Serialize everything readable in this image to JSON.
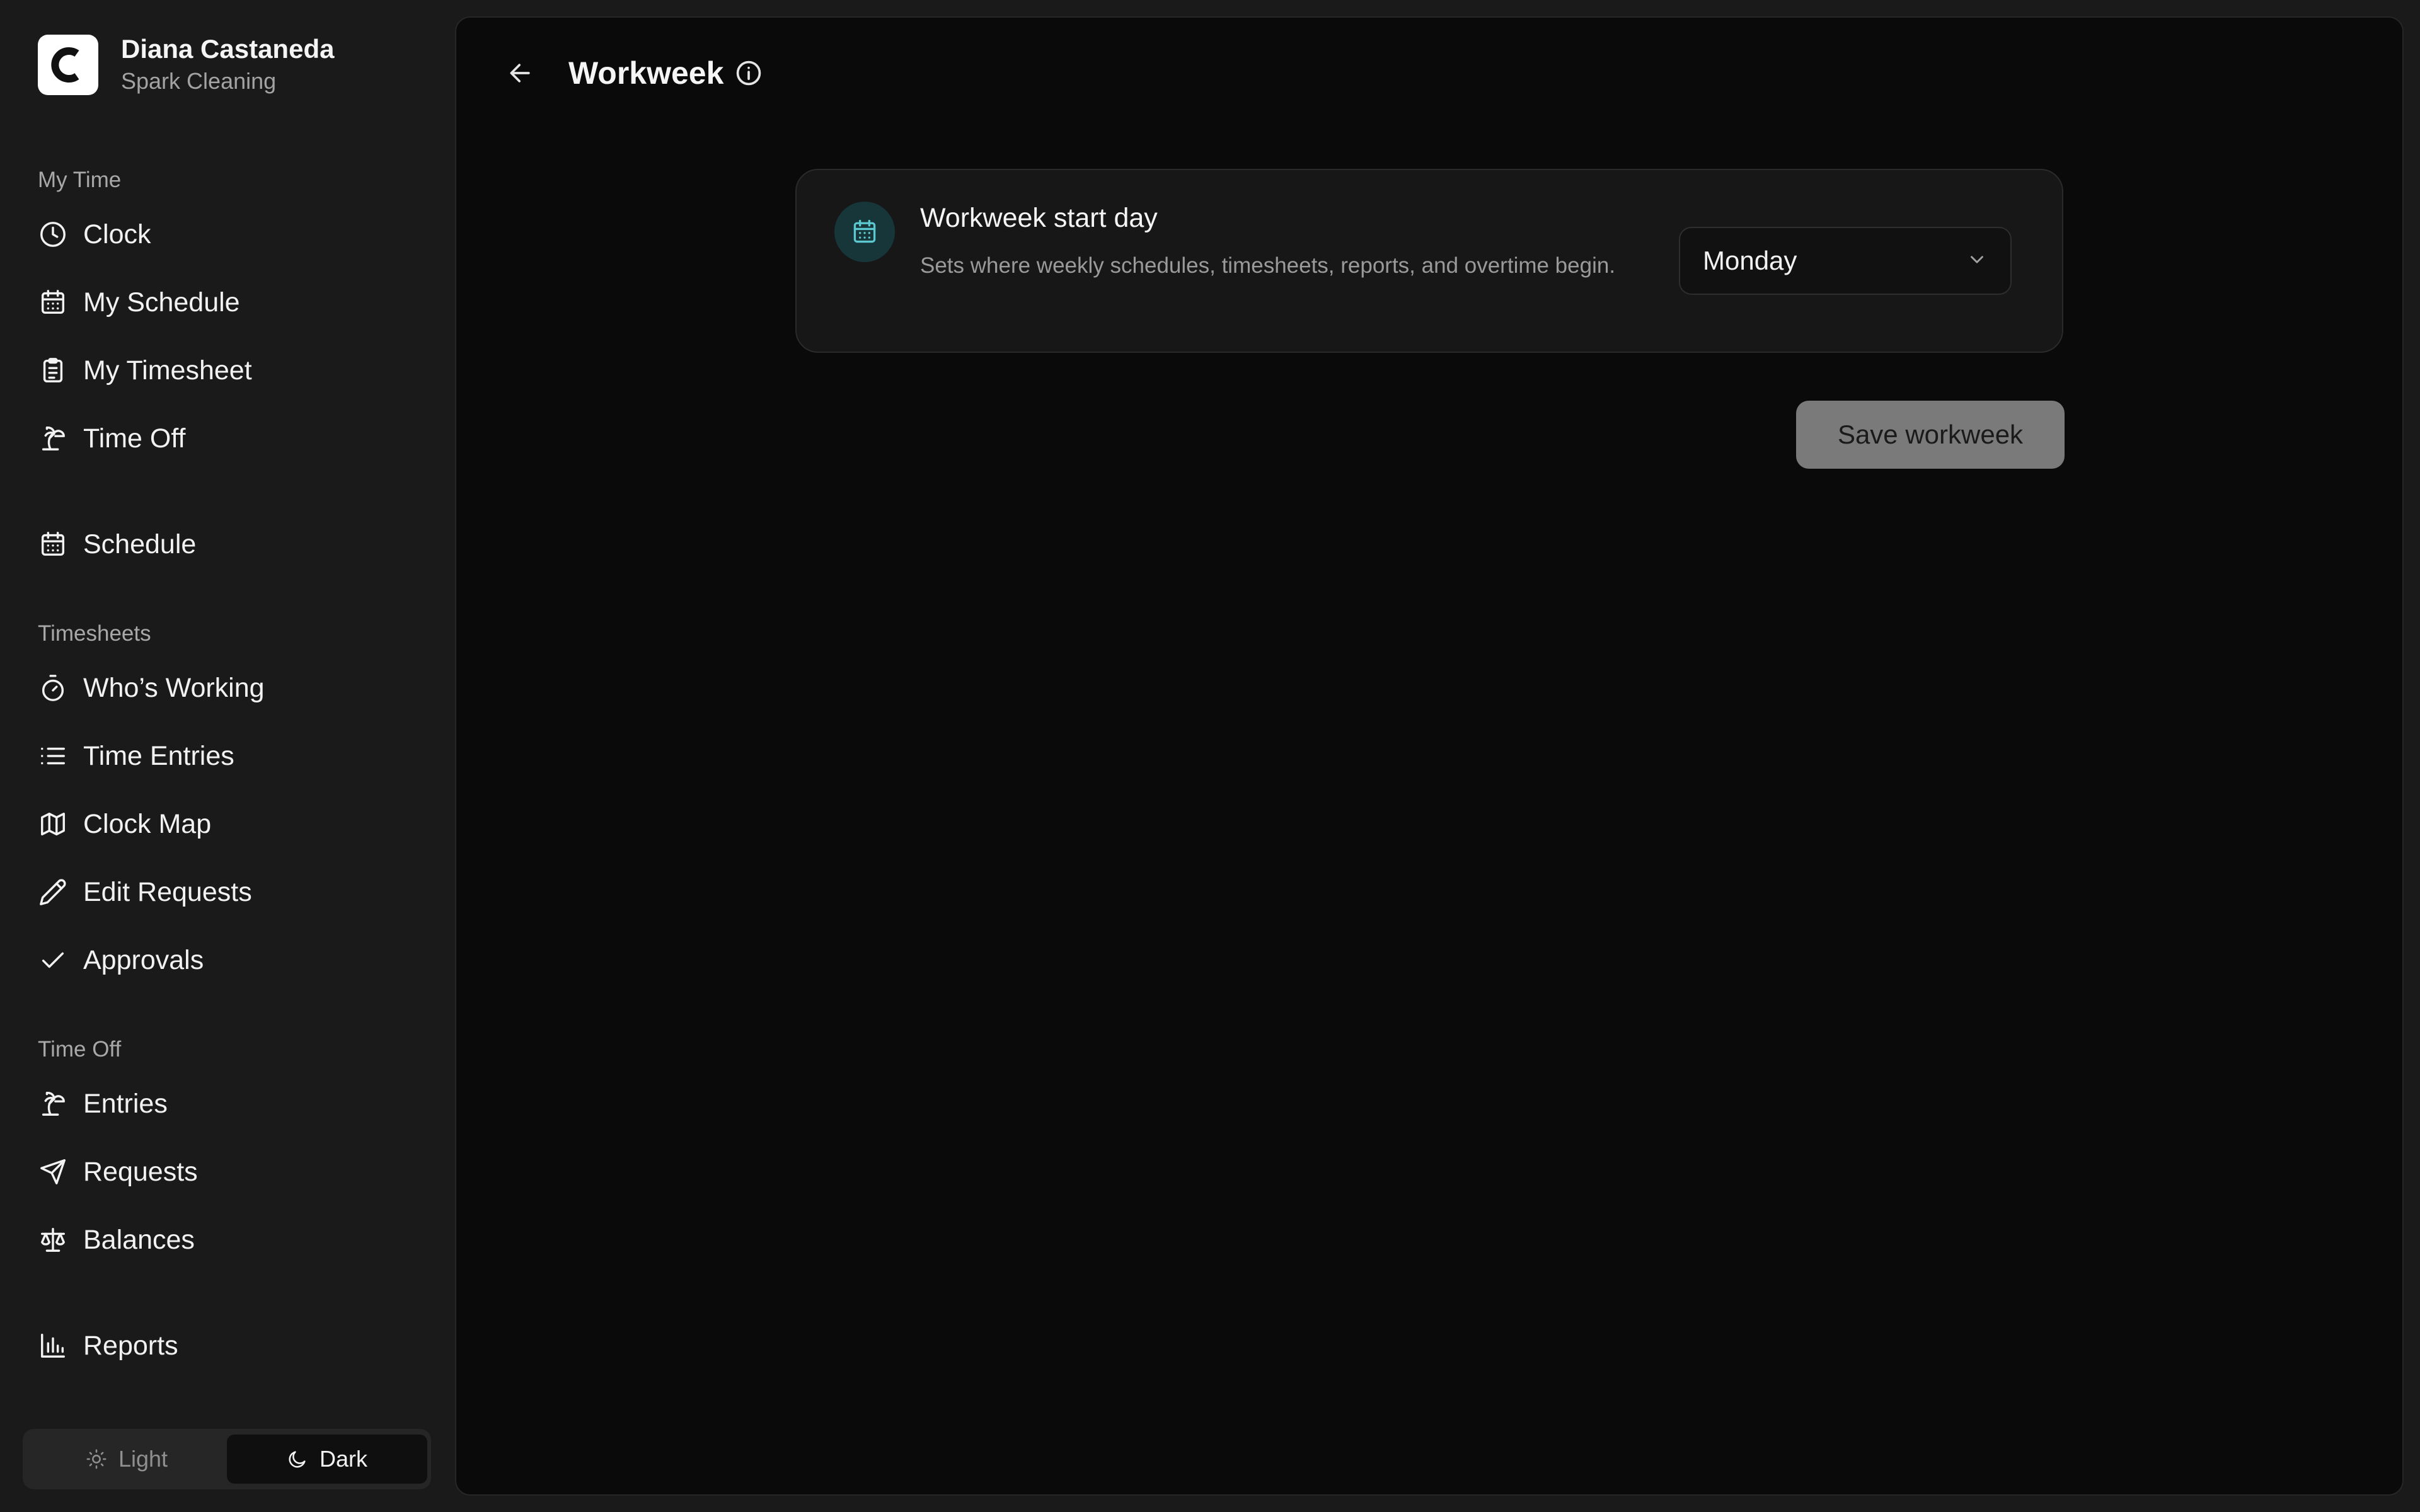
{
  "user": {
    "name": "Diana Castaneda",
    "org": "Spark Cleaning",
    "logo_letter": "C"
  },
  "sidebar": {
    "sections": {
      "my_time": "My Time",
      "timesheets": "Timesheets",
      "time_off": "Time Off"
    },
    "items": {
      "clock": "Clock",
      "my_schedule": "My Schedule",
      "my_timesheet": "My Timesheet",
      "time_off": "Time Off",
      "schedule": "Schedule",
      "whos_working": "Who’s Working",
      "time_entries": "Time Entries",
      "clock_map": "Clock Map",
      "edit_requests": "Edit Requests",
      "approvals": "Approvals",
      "entries": "Entries",
      "requests": "Requests",
      "balances": "Balances",
      "reports": "Reports"
    },
    "theme": {
      "light": "Light",
      "dark": "Dark",
      "selected": "Dark"
    }
  },
  "main": {
    "title": "Workweek",
    "card": {
      "title": "Workweek start day",
      "description": "Sets where weekly schedules, timesheets, reports, and overtime begin.",
      "selected_day": "Monday"
    },
    "save_label": "Save workweek"
  },
  "colors": {
    "sidebar_bg": "#1a1a1a",
    "main_bg": "#0a0a0a",
    "card_bg": "#171717",
    "accent_teal": "#5cc8d0",
    "save_button_bg": "#7a7a7a"
  }
}
